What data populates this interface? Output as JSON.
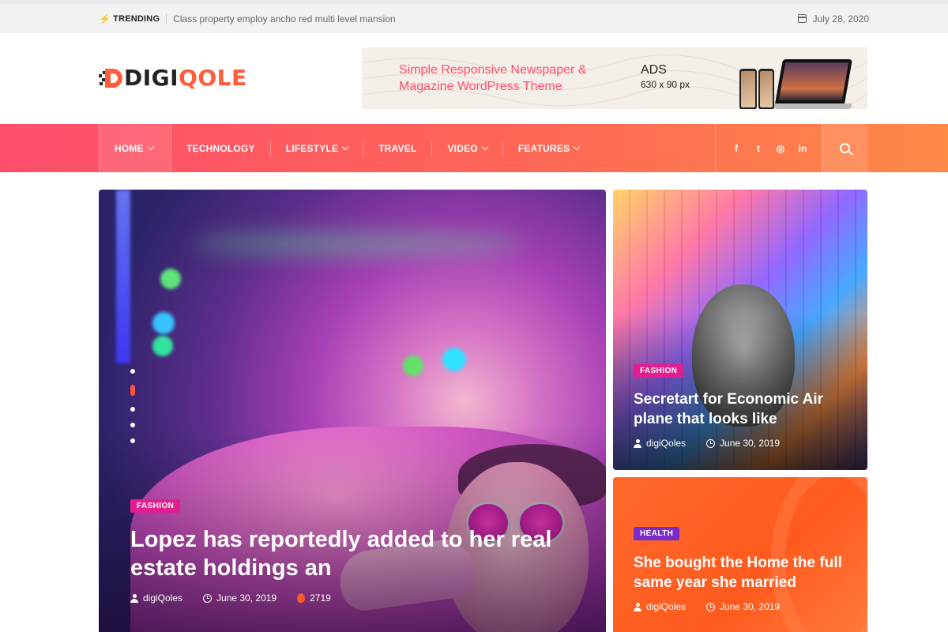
{
  "topbar": {
    "trending_label": "TRENDING",
    "trending_text": "Class property employ ancho red multi level mansion",
    "date": "July 28, 2020"
  },
  "logo": {
    "part1": "DIGI",
    "part2": "QOLE"
  },
  "ad": {
    "line1": "Simple Responsive Newspaper &",
    "line2": "Magazine WordPress Theme",
    "label": "ADS",
    "size": "630 x 90 px"
  },
  "nav": {
    "items": [
      {
        "label": "HOME",
        "has_dropdown": true,
        "active": true
      },
      {
        "label": "TECHNOLOGY",
        "has_dropdown": false
      },
      {
        "label": "LIFESTYLE",
        "has_dropdown": true
      },
      {
        "label": "TRAVEL",
        "has_dropdown": false
      },
      {
        "label": "VIDEO",
        "has_dropdown": true
      },
      {
        "label": "FEATURES",
        "has_dropdown": true
      }
    ],
    "social": [
      "f",
      "t",
      "◎",
      "in"
    ]
  },
  "hero": {
    "category": "FASHION",
    "title": "Lopez has reportedly added to her real estate holdings an",
    "author": "digiQoles",
    "date": "June 30, 2019",
    "views": "2719",
    "slide_active": 1
  },
  "card1": {
    "category": "FASHION",
    "title": "Secretart for Economic Air plane that looks like",
    "author": "digiQoles",
    "date": "June 30, 2019"
  },
  "card2": {
    "category": "HEALTH",
    "title": "She bought the Home the full same year she married",
    "author": "digiQoles",
    "date": "June 30, 2019"
  },
  "colors": {
    "accent": "#ff5e3a",
    "nav_gradient_start": "#ff4e6c",
    "nav_gradient_end": "#ff8a48",
    "fashion_badge": "#e11d8f",
    "health_badge": "#7a2bc9"
  }
}
